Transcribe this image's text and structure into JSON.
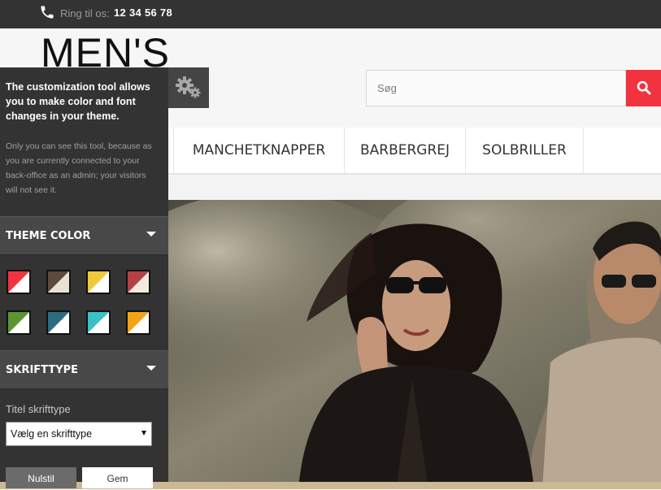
{
  "topbar": {
    "phone_label": "Ring til os:",
    "phone_number": "12 34 56 78",
    "phone_icon": "phone-icon"
  },
  "header": {
    "logo_text": "MEN'S",
    "search": {
      "placeholder": "Søg",
      "value": "",
      "icon": "search-icon"
    }
  },
  "nav": {
    "items": [
      {
        "label": "MANCHETKNAPPER"
      },
      {
        "label": "BARBERGREJ"
      },
      {
        "label": "SOLBRILLER"
      }
    ]
  },
  "customizer": {
    "gear_icon": "gears-icon",
    "title": "The customization tool allows you to make color and font changes in your theme.",
    "info": "Only you can see this tool, because as you are currently connected to your back-office as an admin; your visitors will not see it.",
    "theme_color_label": "THEME COLOR",
    "swatches": [
      {
        "primary": "#f13340",
        "secondary": "#ffffff"
      },
      {
        "primary": "#5c4a3d",
        "secondary": "#e8e2d6"
      },
      {
        "primary": "#f0c93a",
        "secondary": "#ffffff"
      },
      {
        "primary": "#b54144",
        "secondary": "#f0ebde"
      },
      {
        "primary": "#5e9332",
        "secondary": "#ffffff"
      },
      {
        "primary": "#2c6c80",
        "secondary": "#ffffff"
      },
      {
        "primary": "#39c1c8",
        "secondary": "#ffffff"
      },
      {
        "primary": "#f3a314",
        "secondary": "#ffffff"
      }
    ],
    "font_section_label": "SKRIFTTYPE",
    "title_font_label": "Titel skrifttype",
    "title_font_select": "Vælg en skrifttype",
    "reset_label": "Nulstil",
    "save_label": "Gem"
  },
  "colors": {
    "accent": "#f13340",
    "topbar_bg": "#333333",
    "panel_bg": "#333333",
    "section_bg": "#484848"
  }
}
